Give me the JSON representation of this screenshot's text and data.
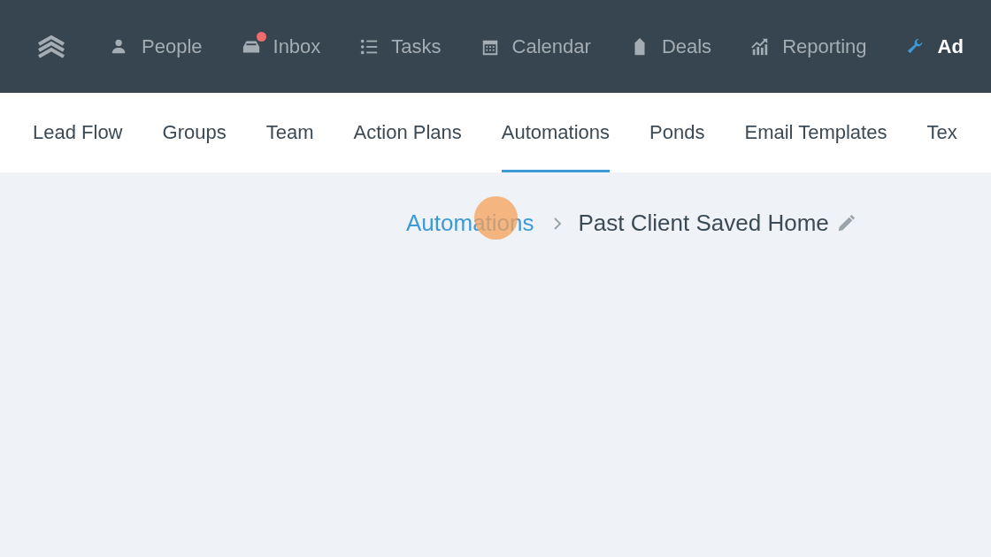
{
  "top_nav": [
    {
      "kind": "logo",
      "selected": false
    },
    {
      "kind": "people",
      "label": "People",
      "selected": false,
      "badge": false
    },
    {
      "kind": "inbox",
      "label": "Inbox",
      "selected": false,
      "badge": true
    },
    {
      "kind": "tasks",
      "label": "Tasks",
      "selected": false,
      "badge": false
    },
    {
      "kind": "calendar",
      "label": "Calendar",
      "selected": false,
      "badge": false
    },
    {
      "kind": "deals",
      "label": "Deals",
      "selected": false,
      "badge": false
    },
    {
      "kind": "reporting",
      "label": "Reporting",
      "selected": false,
      "badge": false
    },
    {
      "kind": "admin",
      "label": "Ad",
      "selected": true,
      "badge": false
    }
  ],
  "sub_nav": [
    {
      "label": "Lead Flow",
      "selected": false
    },
    {
      "label": "Groups",
      "selected": false
    },
    {
      "label": "Team",
      "selected": false
    },
    {
      "label": "Action Plans",
      "selected": false
    },
    {
      "label": "Automations",
      "selected": true
    },
    {
      "label": "Ponds",
      "selected": false
    },
    {
      "label": "Email Templates",
      "selected": false
    },
    {
      "label": "Tex",
      "selected": false
    }
  ],
  "breadcrumb": {
    "parent": "Automations",
    "current": "Past Client Saved Home"
  }
}
